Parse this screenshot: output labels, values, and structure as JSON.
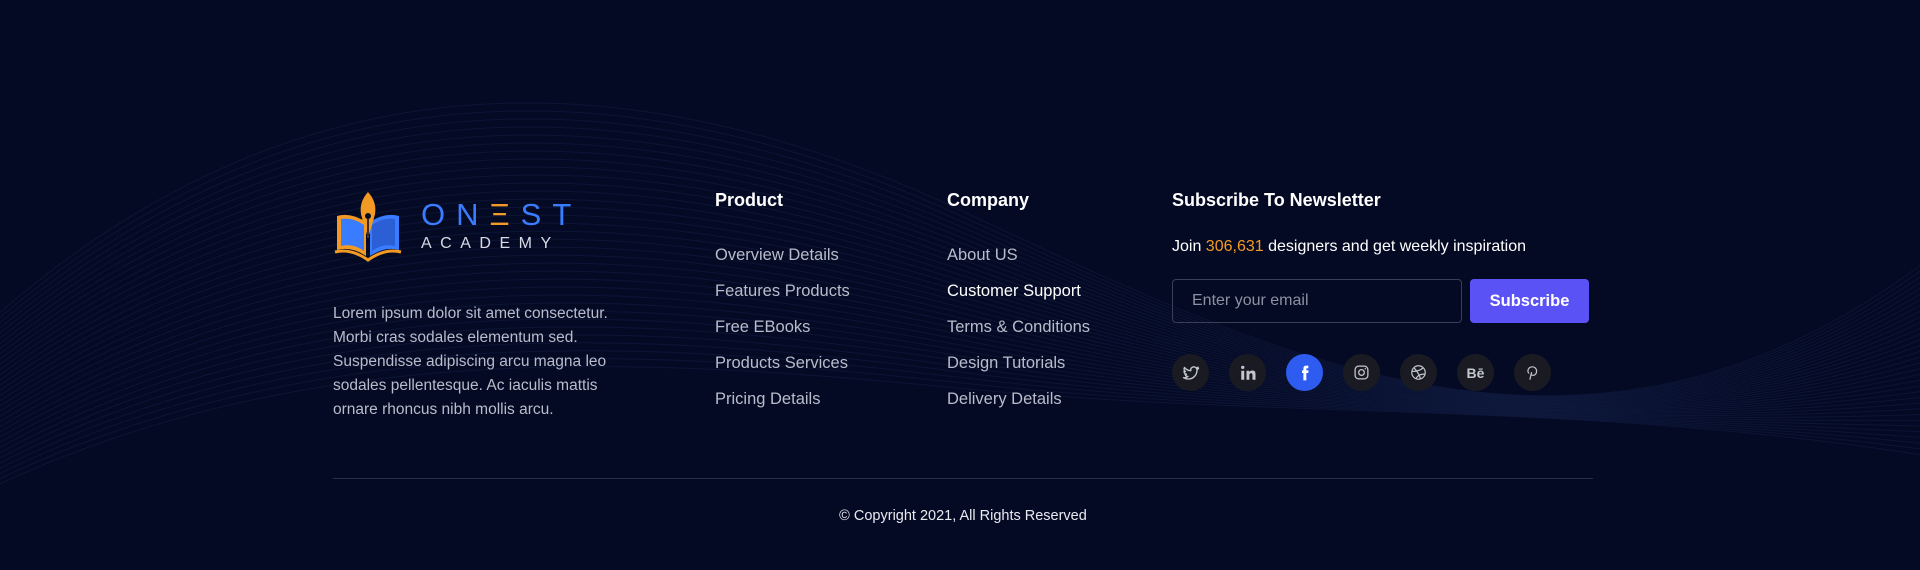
{
  "brand": {
    "logo_name_part1": "ON",
    "logo_name_accent": "Ξ",
    "logo_name_part2": "ST",
    "logo_subtitle": "ACADEMY",
    "description": "Lorem ipsum dolor sit amet consectetur. Morbi cras sodales elementum sed. Suspendisse adipiscing arcu magna leo sodales pellentesque. Ac iaculis mattis ornare rhoncus nibh mollis arcu."
  },
  "product": {
    "title": "Product",
    "links": [
      "Overview Details",
      "Features Products",
      "Free EBooks",
      "Products Services",
      "Pricing Details"
    ]
  },
  "company": {
    "title": "Company",
    "links": [
      "About US",
      "Customer Support",
      "Terms & Conditions",
      "Design Tutorials",
      "Delivery Details"
    ],
    "highlighted_index": 1
  },
  "newsletter": {
    "title": "Subscribe To Newsletter",
    "text_before": "Join ",
    "count": "306,631",
    "text_after": " designers and get weekly inspiration",
    "email_placeholder": "Enter your email",
    "button_label": "Subscribe"
  },
  "socials": [
    {
      "icon": "twitter-icon",
      "active": false
    },
    {
      "icon": "linkedin-icon",
      "active": false
    },
    {
      "icon": "facebook-icon",
      "active": true
    },
    {
      "icon": "instagram-icon",
      "active": false
    },
    {
      "icon": "dribbble-icon",
      "active": false
    },
    {
      "icon": "behance-icon",
      "active": false,
      "glyph": "Bē"
    },
    {
      "icon": "pinterest-icon",
      "active": false
    }
  ],
  "copyright": "© Copyright 2021, All Rights Reserved",
  "colors": {
    "background": "#050a24",
    "brand_blue": "#3a7cff",
    "accent_orange": "#f39a24",
    "button_purple": "#5b52f5",
    "social_active": "#2f5cf0"
  }
}
